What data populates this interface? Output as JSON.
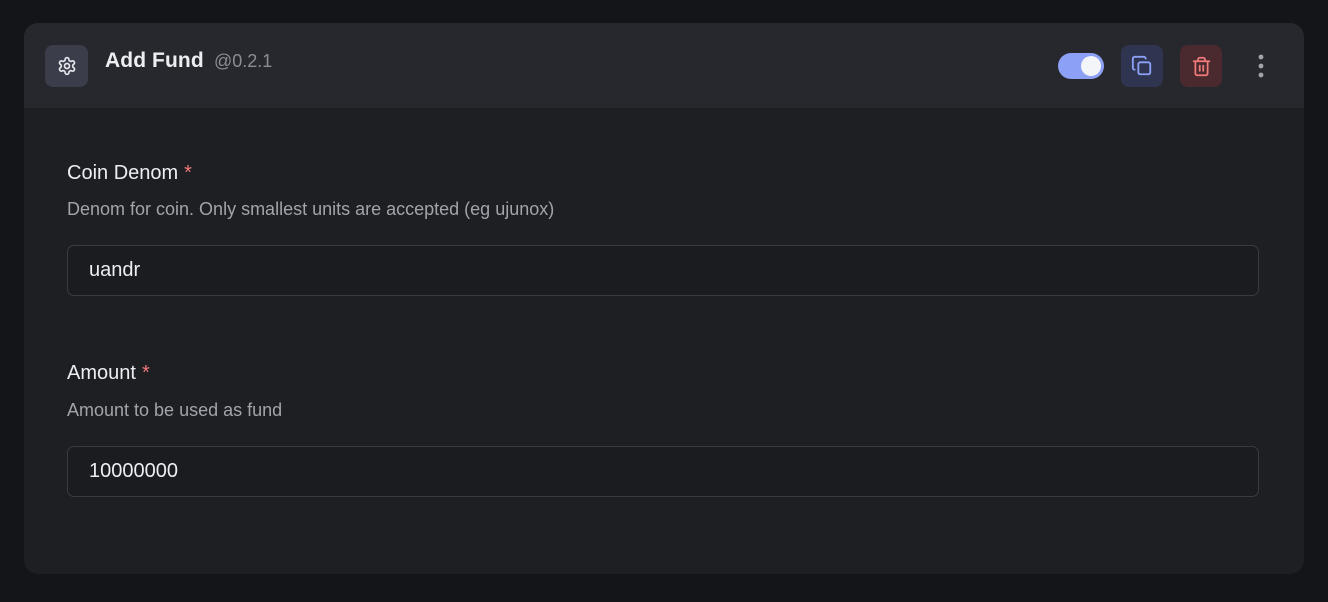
{
  "header": {
    "title": "Add Fund",
    "version": "@0.2.1",
    "enabled": true,
    "icon": "gear-icon",
    "actions": {
      "copy_icon": "copy-icon",
      "delete_icon": "trash-icon",
      "more_icon": "more-vertical-icon"
    }
  },
  "fields": [
    {
      "label": "Coin Denom",
      "required_mark": "*",
      "help": "Denom for coin. Only smallest units are accepted (eg ujunox)",
      "value": "uandr"
    },
    {
      "label": "Amount",
      "required_mark": "*",
      "help": "Amount to be used as fund",
      "value": "10000000"
    }
  ],
  "colors": {
    "background": "#141519",
    "card": "#1e1f23",
    "header": "#27282d",
    "accent": "#8ca0f5",
    "danger": "#f07a7a",
    "required": "#f07a7a"
  }
}
